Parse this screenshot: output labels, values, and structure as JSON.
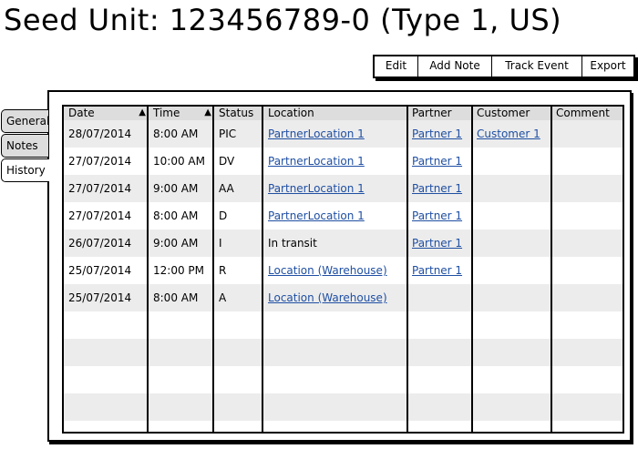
{
  "page": {
    "title": "Seed Unit: 123456789-0 (Type 1, US)"
  },
  "toolbar": {
    "edit": "Edit",
    "add_note": "Add Note",
    "track_event": "Track Event",
    "export": "Export"
  },
  "tabs": [
    {
      "label": "General",
      "active": false
    },
    {
      "label": "Notes",
      "active": false
    },
    {
      "label": "History",
      "active": true
    }
  ],
  "table": {
    "columns": [
      "Date",
      "Time",
      "Status",
      "Location",
      "Partner",
      "Customer",
      "Comment"
    ],
    "sort_icon": "triangle-up-icon",
    "rows": [
      {
        "date": "28/07/2014",
        "time": "8:00 AM",
        "status": "PIC",
        "location": "PartnerLocation 1",
        "partner": "Partner 1",
        "customer": "Customer 1",
        "comment": ""
      },
      {
        "date": "27/07/2014",
        "time": "10:00 AM",
        "status": "DV",
        "location": "PartnerLocation 1",
        "partner": "Partner 1",
        "customer": "",
        "comment": ""
      },
      {
        "date": "27/07/2014",
        "time": "9:00 AM",
        "status": "AA",
        "location": "PartnerLocation 1",
        "partner": "Partner 1",
        "customer": "",
        "comment": ""
      },
      {
        "date": "27/07/2014",
        "time": "8:00 AM",
        "status": "D",
        "location": "PartnerLocation 1",
        "partner": "Partner 1",
        "customer": "",
        "comment": ""
      },
      {
        "date": "26/07/2014",
        "time": "9:00 AM",
        "status": "I",
        "location": "In transit",
        "partner": "Partner 1",
        "customer": "",
        "comment": ""
      },
      {
        "date": "25/07/2014",
        "time": "12:00 PM",
        "status": "R",
        "location": "Location (Warehouse)",
        "partner": "Partner 1",
        "customer": "",
        "comment": ""
      },
      {
        "date": "25/07/2014",
        "time": "8:00 AM",
        "status": "A",
        "location": "Location (Warehouse)",
        "partner": "",
        "customer": "",
        "comment": ""
      }
    ],
    "link_color": "#1f4fa3",
    "stripe_color": "#ececec"
  }
}
